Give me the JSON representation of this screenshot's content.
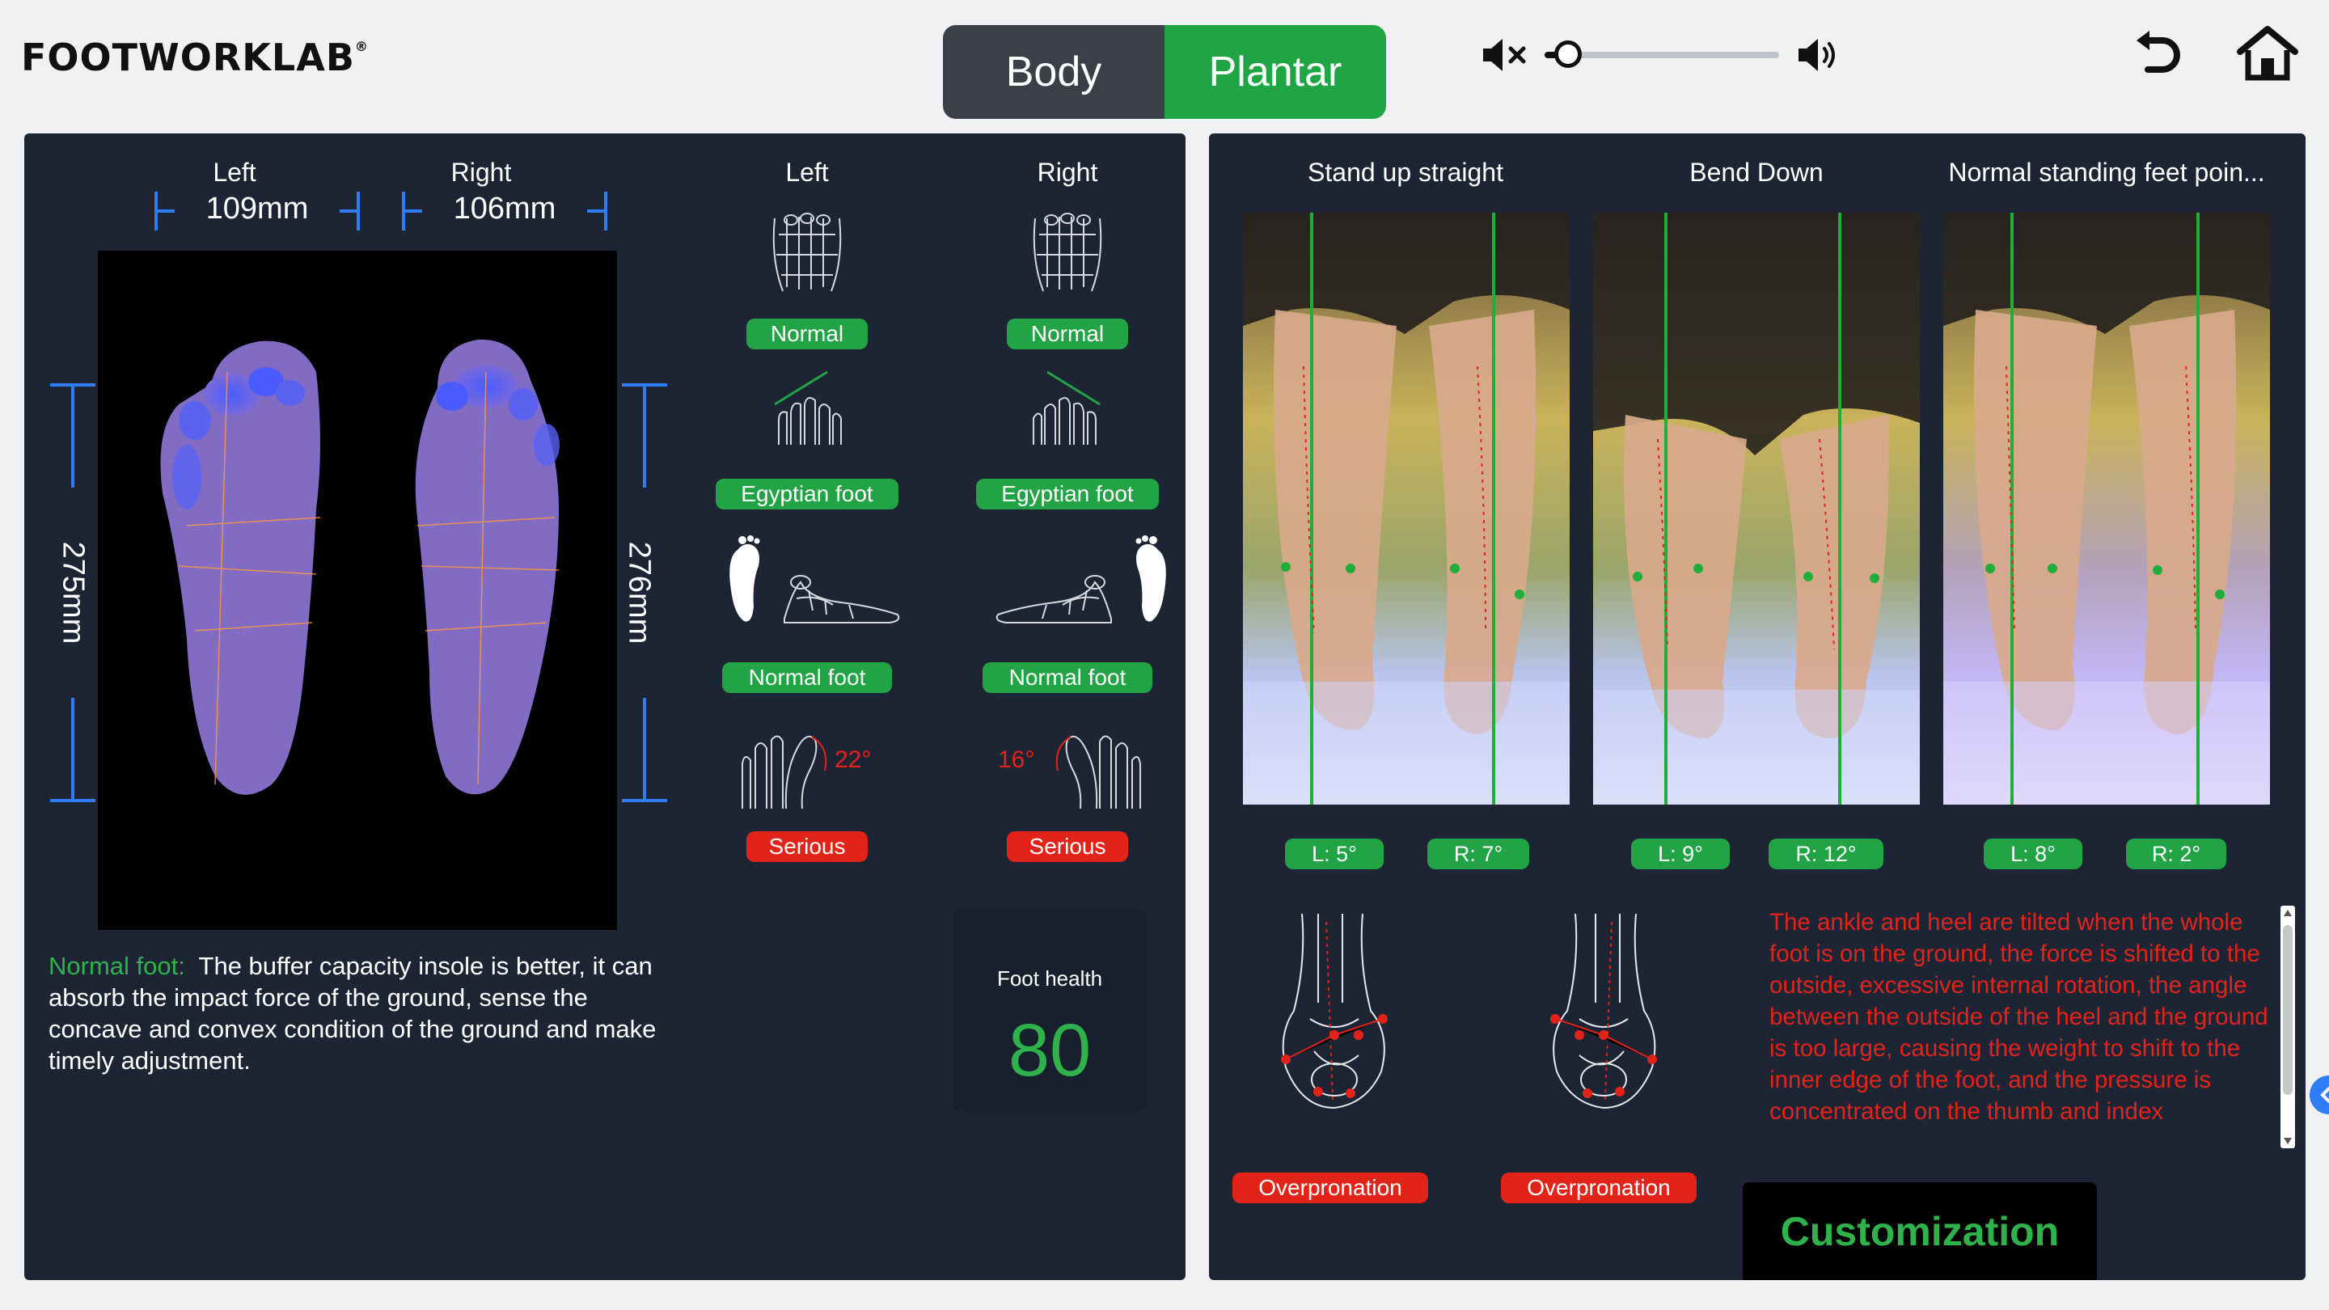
{
  "brand": {
    "logo_text": "FOOTWORKLAB",
    "logo_mark": "®"
  },
  "mode_toggle": {
    "body_label": "Body",
    "plantar_label": "Plantar",
    "active": "Plantar"
  },
  "volume": {
    "level": 0.1
  },
  "foot_scan": {
    "left_label": "Left",
    "right_label": "Right",
    "left_width": "109mm",
    "right_width": "106mm",
    "left_length": "275mm",
    "right_length": "276mm"
  },
  "analysis": {
    "left_header": "Left",
    "right_header": "Right",
    "left": {
      "arch_type": "Normal",
      "toe_shape": "Egyptian foot",
      "arch_height": "Normal foot",
      "hallux_angle": "22°",
      "hallux_status": "Serious"
    },
    "right": {
      "arch_type": "Normal",
      "toe_shape": "Egyptian foot",
      "arch_height": "Normal foot",
      "hallux_angle": "16°",
      "hallux_status": "Serious"
    }
  },
  "description": {
    "highlight": "Normal foot:",
    "text": "The buffer capacity insole is better, it can absorb the impact force of the ground, sense the concave and convex condition of the ground and make timely adjustment."
  },
  "foot_health": {
    "label": "Foot health",
    "score": "80"
  },
  "posture": {
    "columns": [
      {
        "title": "Stand up straight",
        "left_angle": "L: 5°",
        "right_angle": "R: 7°"
      },
      {
        "title": "Bend Down",
        "left_angle": "L: 9°",
        "right_angle": "R: 12°"
      },
      {
        "title": "Normal standing feet poin...",
        "left_angle": "L: 8°",
        "right_angle": "R: 2°"
      }
    ],
    "left_result": "Overpronation",
    "right_result": "Overpronation",
    "advice": "The ankle and heel are tilted when the whole foot is on the ground, the force is shifted to the outside, excessive internal rotation, the angle between the outside of the heel and the ground is too large, causing the weight to shift to the inner edge of the foot, and the pressure is concentrated on the thumb and index"
  },
  "customization_label": "Customization",
  "colors": {
    "panel": "#1d2535",
    "accent_green": "#22a345",
    "alert_red": "#e2231a"
  }
}
